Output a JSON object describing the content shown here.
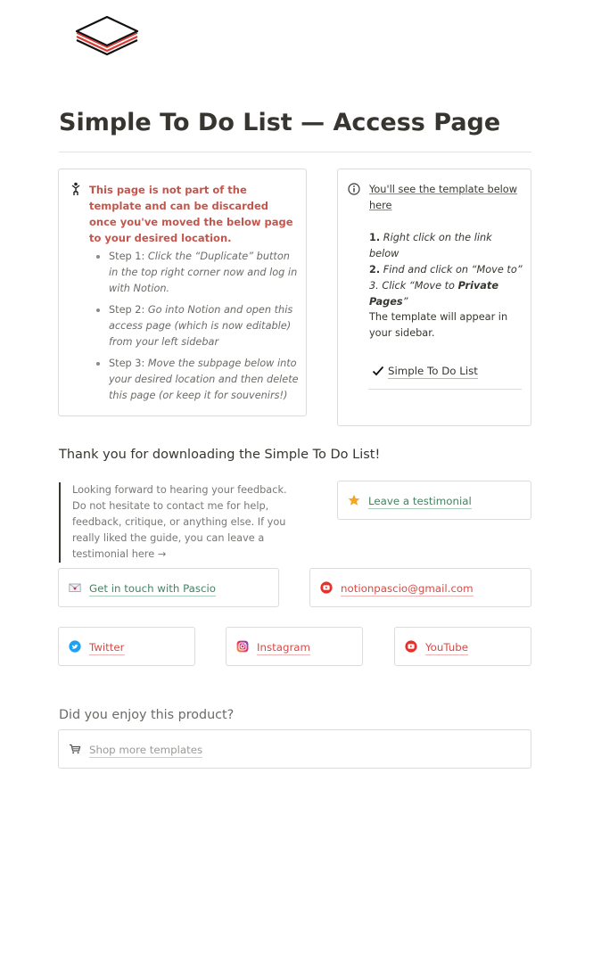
{
  "header": {
    "logo_icon": "layered-stack-logo",
    "title": "Simple To Do List  — Access Page"
  },
  "left_callout": {
    "icon": "pin-figure-icon",
    "warning": "This page is not part of the template and can be discarded once you've moved the below page to your desired location.",
    "steps": [
      {
        "prefix": "Step 1: ",
        "text": "Click the “Duplicate” button in the top right corner now and log in with Notion."
      },
      {
        "prefix": "Step 2: ",
        "text": "Go into Notion and open this access page (which is now editable) from your left sidebar"
      },
      {
        "prefix": "Step 3: ",
        "text": "Move the subpage below into your desired location and then delete this page (or keep it for souvenirs!)"
      }
    ]
  },
  "right_callout": {
    "icon": "info-icon",
    "see_template": "You'll see the template below here",
    "instructions": [
      {
        "num": "1.",
        "text": "Right click on the link below"
      },
      {
        "num": "2.",
        "text": "Find and click on “Move to”"
      },
      {
        "num": "3.",
        "text": "Click “Move to ",
        "bold": "Private Pages",
        "end": "”"
      }
    ],
    "appear": "The template will appear in your sidebar.",
    "page_link": {
      "icon": "checkmark-icon",
      "label": "Simple To Do List"
    }
  },
  "thanks": "Thank you for downloading the Simple To Do List!",
  "quote": "Looking forward to hearing your feedback. Do not hesitate to contact me for help, feedback, critique, or anything else. If you really liked the guide, you can leave a testimonial here →",
  "links": {
    "testimonial": {
      "label": "Leave a testimonial",
      "icon": "star-icon"
    },
    "contact": {
      "label": "Get in touch with Pascio",
      "icon": "envelope-heart-icon"
    },
    "email": {
      "label": "notionpascio@gmail.com",
      "icon": "youtube-icon"
    },
    "twitter": {
      "label": "Twitter",
      "icon": "twitter-icon"
    },
    "instagram": {
      "label": "Instagram",
      "icon": "instagram-icon"
    },
    "youtube": {
      "label": "YouTube",
      "icon": "youtube-icon"
    }
  },
  "enjoy": "Did you enjoy this product?",
  "shop": {
    "label": "Shop more templates",
    "icon": "shopping-cart-icon"
  },
  "colors": {
    "text": "#37352f",
    "warning_red": "#c4554d",
    "link_green": "#448361",
    "link_red": "#d44c47",
    "link_grey": "#9b9a97",
    "border": "#dddcd9"
  }
}
